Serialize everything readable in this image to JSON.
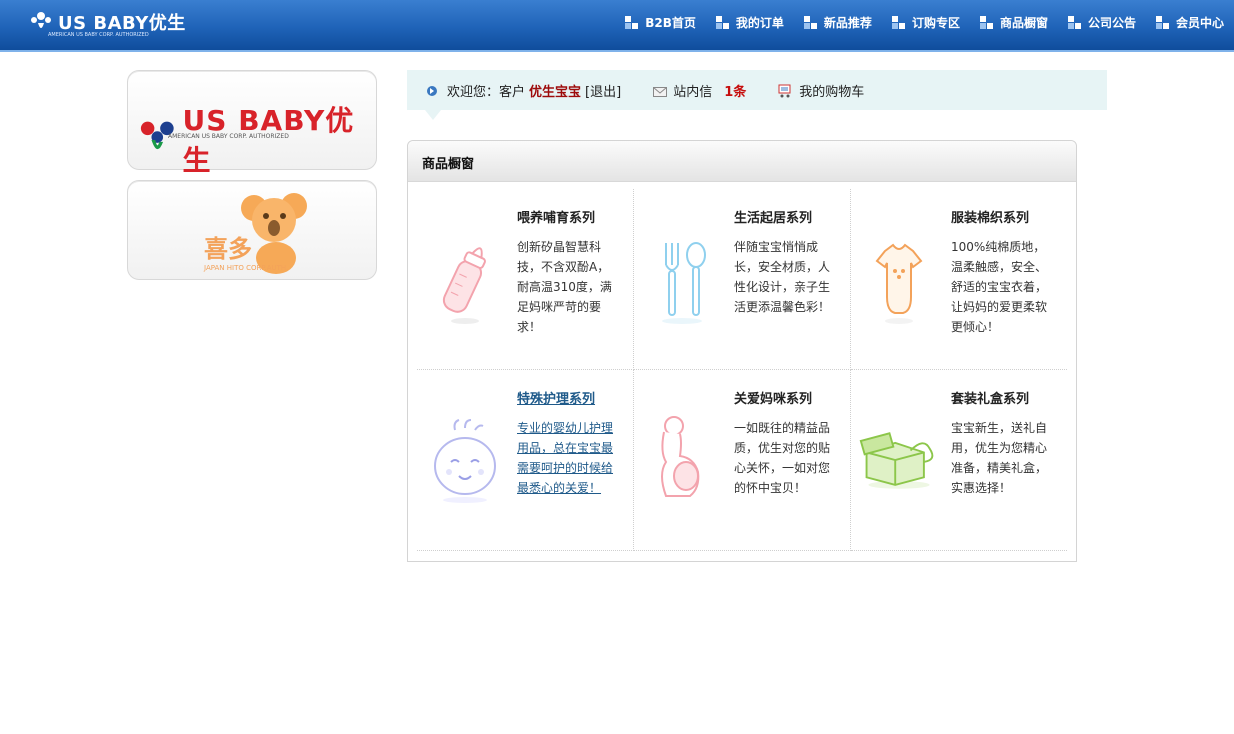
{
  "header": {
    "brand": "US BABY优生",
    "brand_sub": "AMERICAN US BABY CORP. AUTHORIZED",
    "nav": [
      {
        "label": "B2B首页"
      },
      {
        "label": "我的订单"
      },
      {
        "label": "新品推荐"
      },
      {
        "label": "订购专区"
      },
      {
        "label": "商品橱窗"
      },
      {
        "label": "公司公告"
      },
      {
        "label": "会员中心"
      }
    ]
  },
  "sidebar": {
    "brand1_name": "US BABY优生",
    "brand1_sub": "AMERICAN US BABY CORP. AUTHORIZED",
    "brand2_name": "喜多",
    "brand2_sub": "JAPAN HITO CORP.AUTH."
  },
  "welcome": {
    "greeting": "欢迎您：客户",
    "customer": "优生宝宝",
    "logout": "[退出]",
    "mail_label": "站内信",
    "mail_count": "1条",
    "cart_label": "我的购物车"
  },
  "showcase": {
    "title": "商品橱窗",
    "items": [
      {
        "title": "喂养哺育系列",
        "desc": "创新矽晶智慧科技，不含双酚A，耐高温310度，满足妈咪严苛的要求！",
        "icon": "bottle-icon"
      },
      {
        "title": "生活起居系列",
        "desc": "伴随宝宝悄悄成长，安全材质，人性化设计，亲子生活更添温馨色彩！",
        "icon": "utensils-icon"
      },
      {
        "title": "服装棉织系列",
        "desc": "100%纯棉质地，温柔触感，安全、舒适的宝宝衣着，让妈妈的爱更柔软更倾心！",
        "icon": "onesie-icon"
      },
      {
        "title": "特殊护理系列",
        "desc": "专业的婴幼儿护理用品，总在宝宝最需要呵护的时候给最悉心的关爱！",
        "icon": "baby-face-icon"
      },
      {
        "title": "关爱妈咪系列",
        "desc": "一如既往的精益品质，优生对您的贴心关怀，一如对您的怀中宝贝！",
        "icon": "pregnant-mom-icon"
      },
      {
        "title": "套装礼盒系列",
        "desc": "宝宝新生，送礼自用，优生为您精心准备，精美礼盒，实惠选择！",
        "icon": "gift-box-icon"
      }
    ]
  },
  "colors": {
    "top_bar": "#1f63b8",
    "accent_red": "#c60d0d",
    "welcome_bg": "#e7f4f5",
    "link": "#1f5a8a"
  }
}
